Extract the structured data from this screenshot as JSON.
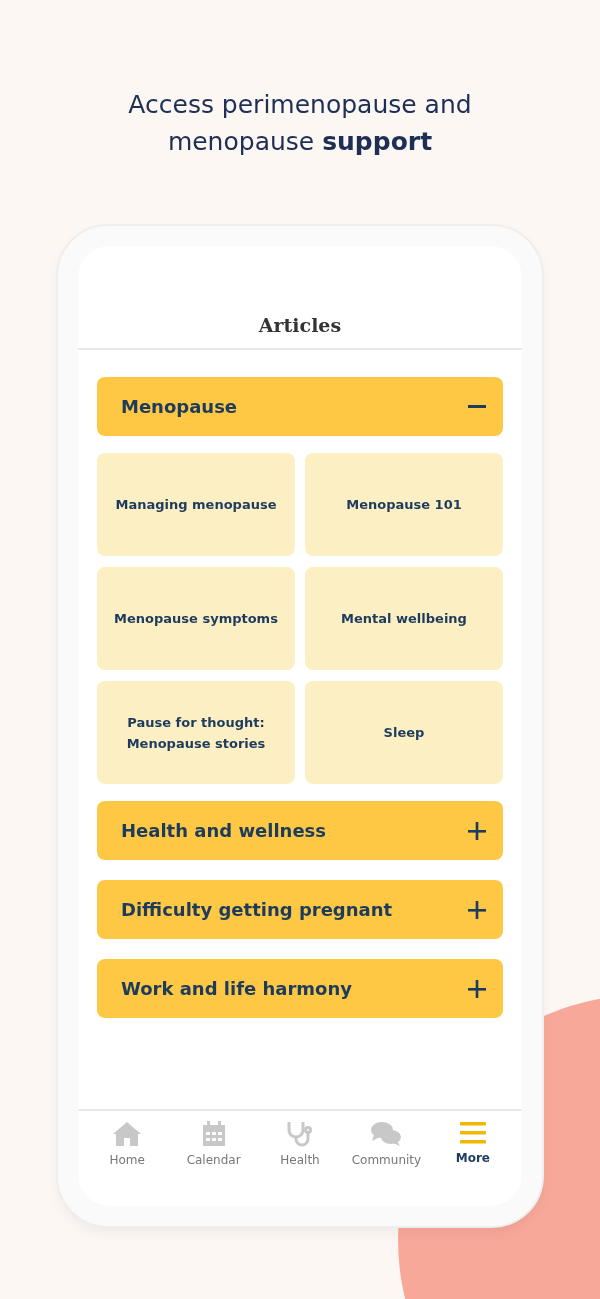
{
  "headline": "Access perimenopause and menopause **support**",
  "screen_title": "Articles",
  "sections": [
    {
      "title": "Menopause",
      "expanded": true,
      "items": [
        "Managing menopause",
        "Menopause 101",
        "Menopause symptoms",
        "Mental wellbeing",
        "Pause for thought: Menopause stories",
        "Sleep"
      ]
    },
    {
      "title": "Health and wellness",
      "expanded": false
    },
    {
      "title": "Difficulty getting pregnant",
      "expanded": false
    },
    {
      "title": "Work and life harmony",
      "expanded": false
    }
  ],
  "nav": [
    {
      "label": "Home",
      "selected": false
    },
    {
      "label": "Calendar",
      "selected": false
    },
    {
      "label": "Health",
      "selected": false
    },
    {
      "label": "Community",
      "selected": false
    },
    {
      "label": "More",
      "selected": true
    }
  ]
}
